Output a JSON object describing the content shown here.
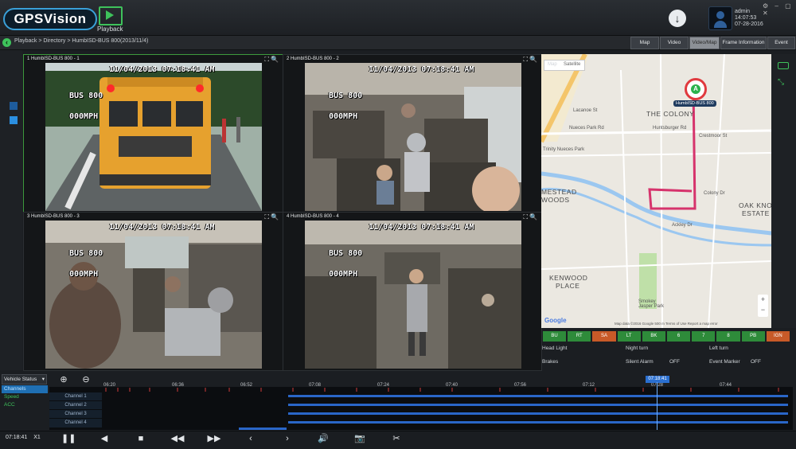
{
  "header": {
    "logo_text": "GPSVision",
    "playback_label": "Playback",
    "user": {
      "name": "admin",
      "time": "14:07:53",
      "date": "07-28-2016"
    },
    "window_controls": "⚙ – ▢ ✕"
  },
  "navbar": {
    "breadcrumb": "Playback > Directory > HumbISD-BUS 800(2013/11/4)",
    "tabs": [
      {
        "label": "Map",
        "active": false
      },
      {
        "label": "Video",
        "active": false
      },
      {
        "label": "Video/Map",
        "active": true
      },
      {
        "label": "Frame Information",
        "active": false
      },
      {
        "label": "Event",
        "active": false
      }
    ]
  },
  "videos": [
    {
      "label": "1 HumbISD-BUS 800 - 1",
      "timestamp": "11/04/2013 07:18:41 AM",
      "bus": "BUS 800",
      "speed": "000MPH"
    },
    {
      "label": "2 HumbISD-BUS 800 - 2",
      "timestamp": "11/04/2013 07:18:41 AM",
      "bus": "BUS 800",
      "speed": "000MPH"
    },
    {
      "label": "3 HumbISD-BUS 800 - 3",
      "timestamp": "11/04/2013 07:18:41 AM",
      "bus": "BUS 800",
      "speed": "000MPH"
    },
    {
      "label": "4 HumbISD-BUS 800 - 4",
      "timestamp": "11/04/2013 07:18:41 AM",
      "bus": "BUS 800",
      "speed": "000MPH"
    }
  ],
  "map": {
    "map_type_options": [
      "Map",
      "Satellite"
    ],
    "marker_label": "HumbISD-BUS 800",
    "marker_letter": "A",
    "labels": {
      "the_colony": "THE COLONY",
      "trinity": "Trinity Nueces Park",
      "mestead": "MESTEAD",
      "woods": "WOODS",
      "oak_knoll": "OAK KNO",
      "estate": "ESTATE",
      "kenwood": "KENWOOD",
      "place": "PLACE",
      "park": "Smokey Jasper Park",
      "lacanoe": "Lacanoe St",
      "nueces": "Nueces Park Rd",
      "huntsburger": "Huntsburger Rd",
      "crestmoor": "Crestmoor St",
      "colony_dr": "Colony Dr",
      "ackley": "Ackley Dr"
    },
    "google": "Google",
    "footer": "Map data ©2016 Google   500 m   Terms of Use   Report a map error",
    "zoom_in": "+",
    "zoom_out": "−"
  },
  "sensors": [
    {
      "label": "BU",
      "color": "#2e8b3a"
    },
    {
      "label": "RT",
      "color": "#2e8b3a"
    },
    {
      "label": "SA",
      "color": "#c85a28"
    },
    {
      "label": "LT",
      "color": "#2e8b3a"
    },
    {
      "label": "BK",
      "color": "#2e8b3a"
    },
    {
      "label": "6",
      "color": "#2e8b3a"
    },
    {
      "label": "7",
      "color": "#2e8b3a"
    },
    {
      "label": "8",
      "color": "#2e8b3a"
    },
    {
      "label": "PB",
      "color": "#2e8b3a"
    },
    {
      "label": "IGN",
      "color": "#c85a28"
    }
  ],
  "status": {
    "head_light": "Head Light",
    "night_turn": "Night turn",
    "left_turn": "Left turn",
    "brakes": "Brakes",
    "silent_alarm": "Silent Alarm",
    "silent_alarm_value": "OFF",
    "event_marker": "Event Marker",
    "event_marker_value": "OFF"
  },
  "timeline": {
    "vehicle_status_label": "Vehicle Status",
    "status_items": [
      "Channels",
      "Speed",
      "ACC"
    ],
    "channels": [
      "Channel 1",
      "Channel 2",
      "Channel 3",
      "Channel 4"
    ],
    "ticks": [
      "06:20",
      "06:36",
      "06:52",
      "07:08",
      "07:24",
      "07:40",
      "07:56",
      "07:12",
      "07:28",
      "07:44"
    ],
    "marker_time": "07:18:41",
    "current_time": "07:18:41",
    "speed": "X1"
  }
}
